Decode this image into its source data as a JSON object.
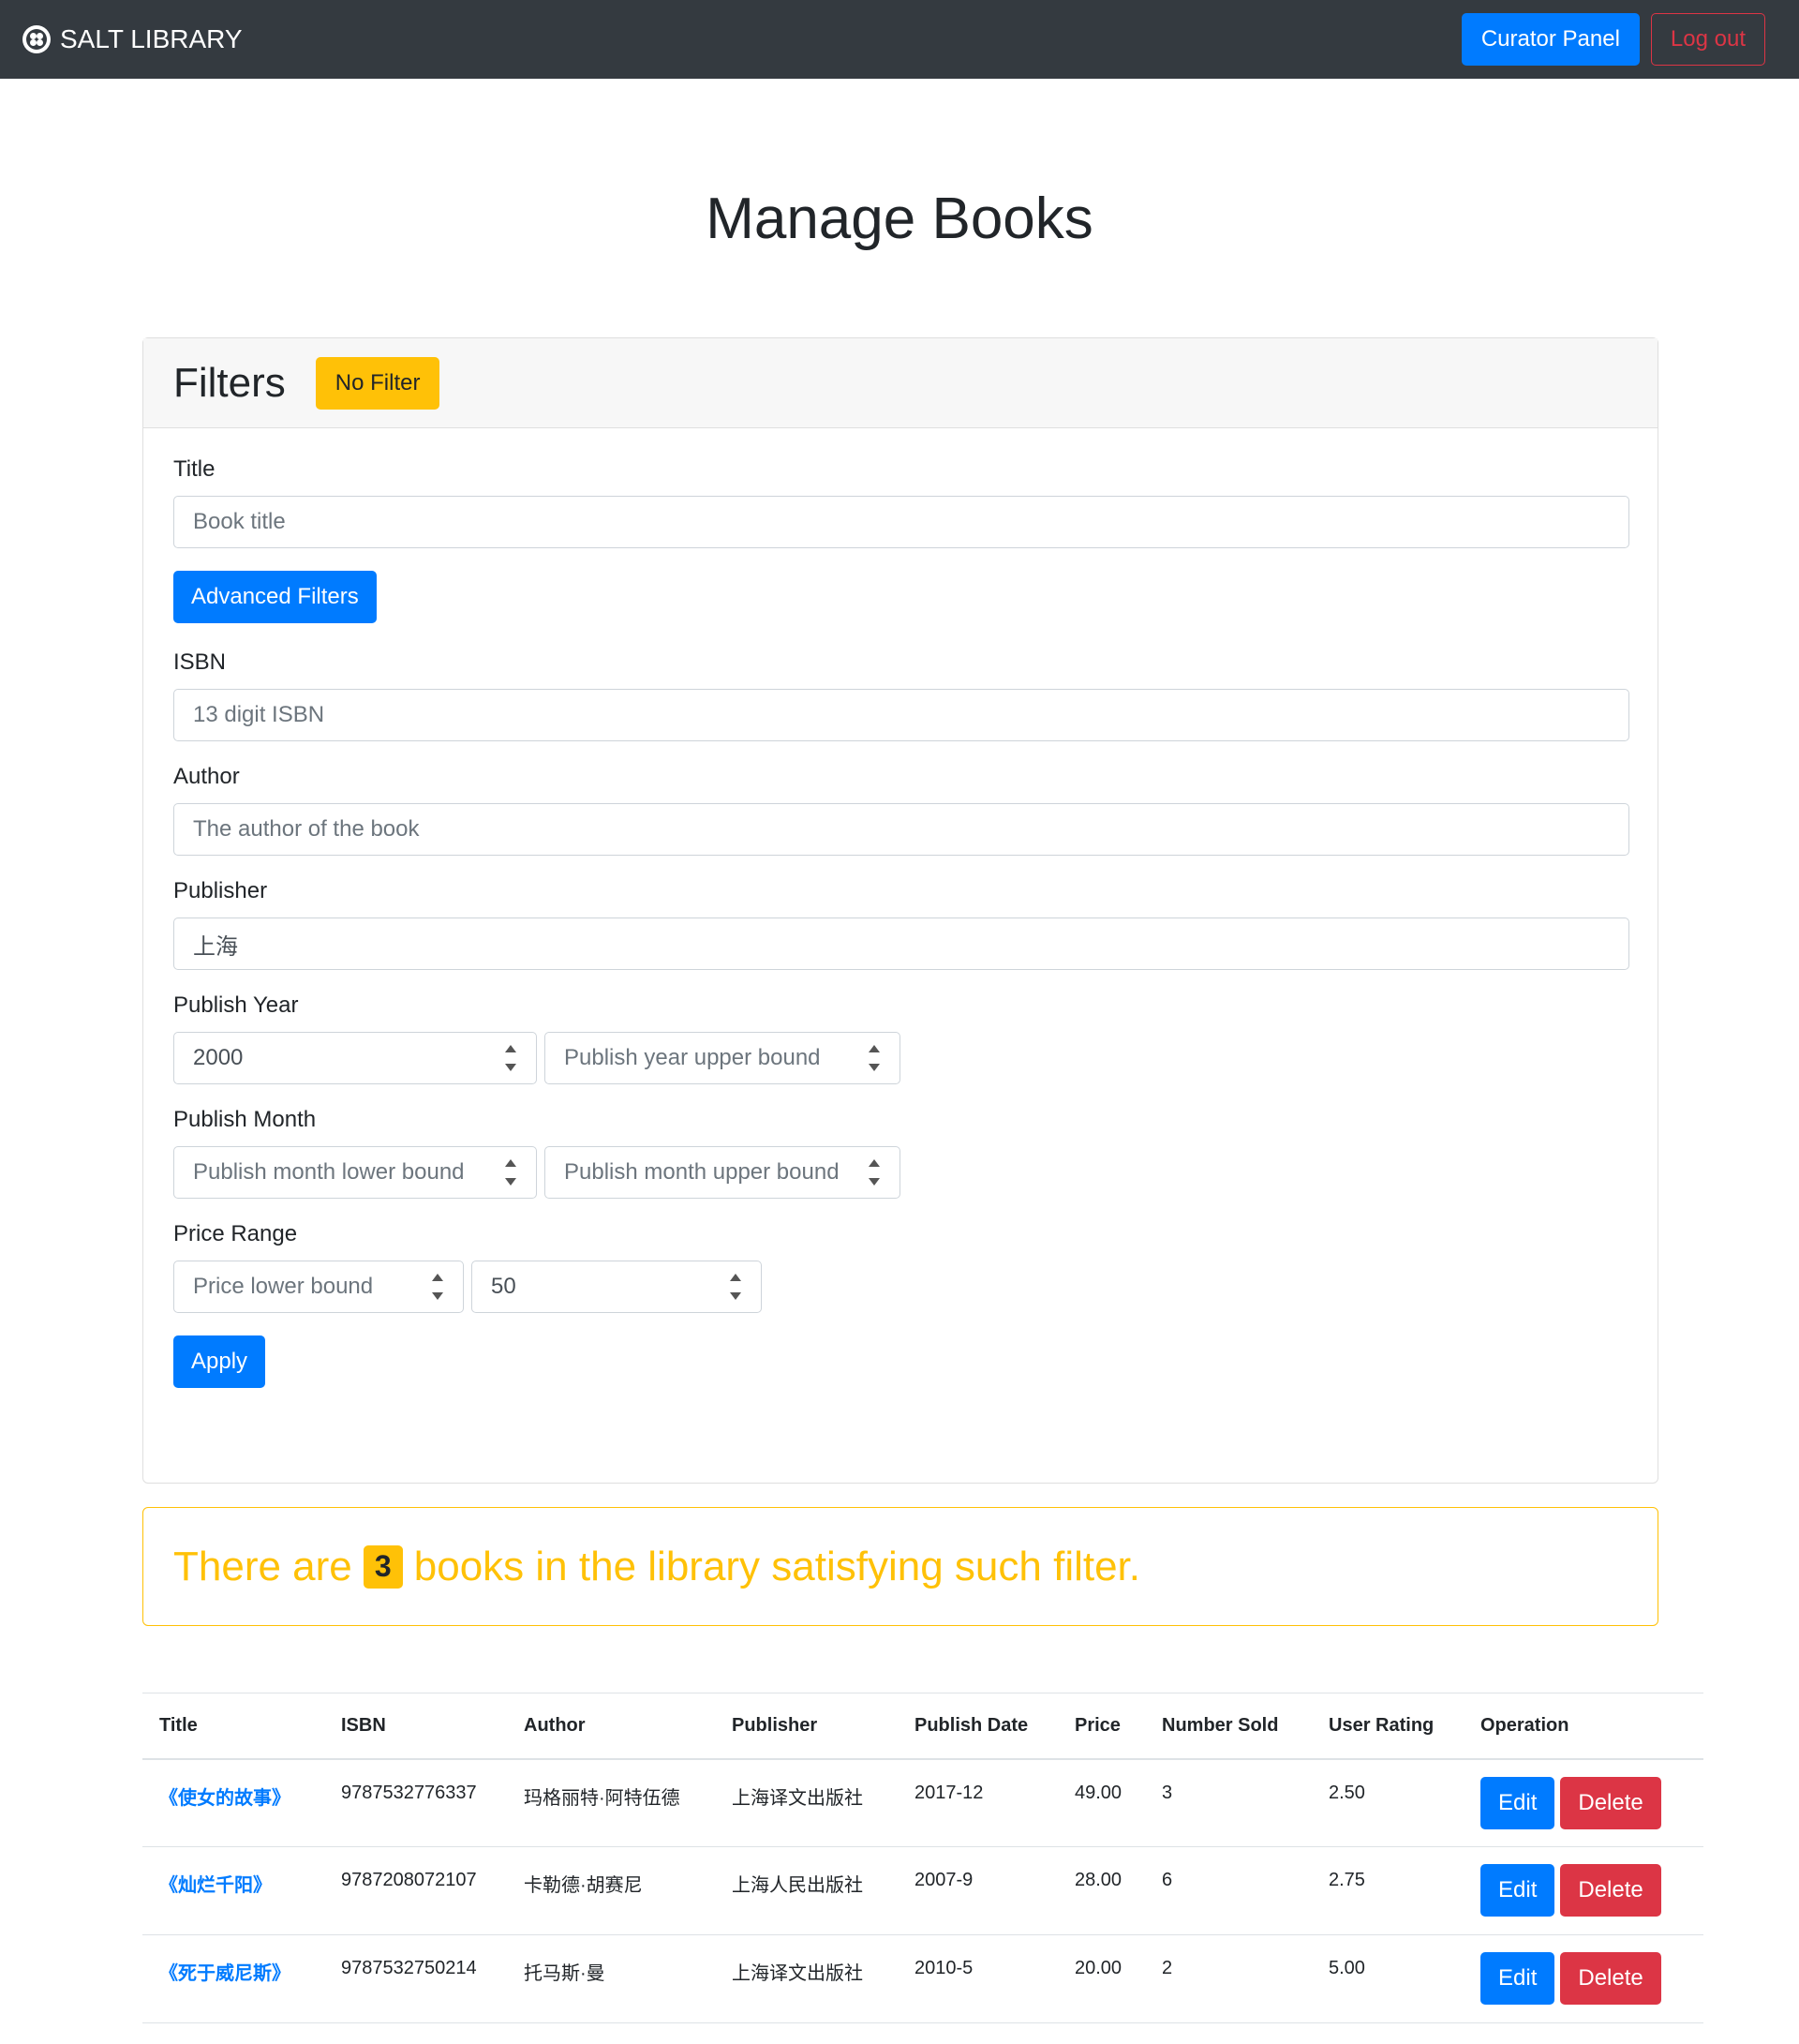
{
  "navbar": {
    "brand": "SALT LIBRARY",
    "curator_panel": "Curator Panel",
    "logout": "Log out"
  },
  "page": {
    "title": "Manage Books"
  },
  "filters": {
    "heading": "Filters",
    "no_filter": "No Filter",
    "title_label": "Title",
    "title_placeholder": "Book title",
    "advanced": "Advanced Filters",
    "isbn_label": "ISBN",
    "isbn_placeholder": "13 digit ISBN",
    "author_label": "Author",
    "author_placeholder": "The author of the book",
    "publisher_label": "Publisher",
    "publisher_value": "上海",
    "year_label": "Publish Year",
    "year_lower_value": "2000",
    "year_upper_placeholder": "Publish year upper bound",
    "month_label": "Publish Month",
    "month_lower_placeholder": "Publish month lower bound",
    "month_upper_placeholder": "Publish month upper bound",
    "price_label": "Price Range",
    "price_lower_placeholder": "Price lower bound",
    "price_upper_value": "50",
    "apply": "Apply"
  },
  "result": {
    "prefix": "There are",
    "count": "3",
    "suffix": "books in the library satisfying such filter."
  },
  "table": {
    "headers": [
      "Title",
      "ISBN",
      "Author",
      "Publisher",
      "Publish Date",
      "Price",
      "Number Sold",
      "User Rating",
      "Operation"
    ],
    "edit": "Edit",
    "delete": "Delete",
    "rows": [
      {
        "title": "《使女的故事》",
        "isbn": "9787532776337",
        "author": "玛格丽特·阿特伍德",
        "publisher": "上海译文出版社",
        "date": "2017-12",
        "price": "49.00",
        "sold": "3",
        "rating": "2.50"
      },
      {
        "title": "《灿烂千阳》",
        "isbn": "9787208072107",
        "author": "卡勒德·胡赛尼",
        "publisher": "上海人民出版社",
        "date": "2007-9",
        "price": "28.00",
        "sold": "6",
        "rating": "2.75"
      },
      {
        "title": "《死于威尼斯》",
        "isbn": "9787532750214",
        "author": "托马斯·曼",
        "publisher": "上海译文出版社",
        "date": "2010-5",
        "price": "20.00",
        "sold": "2",
        "rating": "5.00"
      }
    ]
  },
  "colors": {
    "navbar": "#343a40",
    "primary": "#007bff",
    "danger": "#dc3545",
    "warning": "#ffc107"
  }
}
